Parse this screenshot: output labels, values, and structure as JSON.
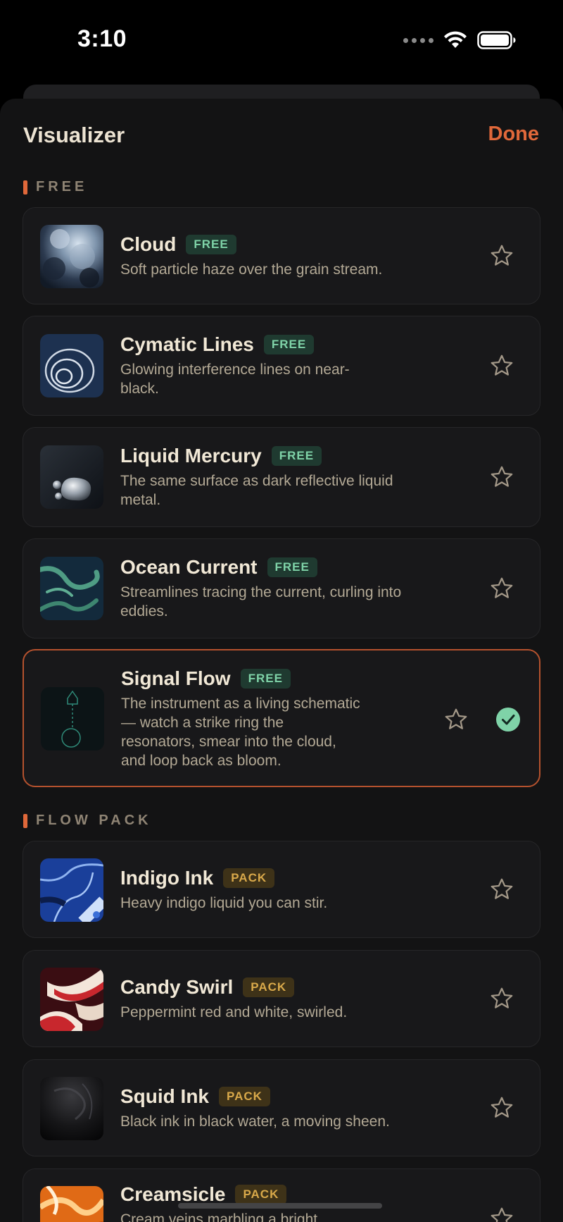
{
  "status_bar": {
    "time": "3:10"
  },
  "header": {
    "title": "Visualizer",
    "done_label": "Done"
  },
  "sections": [
    {
      "label": "FREE"
    },
    {
      "label": "FLOW PACK"
    }
  ],
  "items": [
    {
      "title": "Cloud",
      "badge": "FREE",
      "description": "Soft particle haze over the grain stream."
    },
    {
      "title": "Cymatic Lines",
      "badge": "FREE",
      "description": "Glowing interference lines on near-black."
    },
    {
      "title": "Liquid Mercury",
      "badge": "FREE",
      "description": "The same surface as dark reflective liquid metal."
    },
    {
      "title": "Ocean Current",
      "badge": "FREE",
      "description": "Streamlines tracing the current, curling into eddies."
    },
    {
      "title": "Signal Flow",
      "badge": "FREE",
      "description": "The instrument as a living schematic — watch a strike ring the resonators, smear into the cloud, and loop back as bloom.",
      "selected": true
    },
    {
      "title": "Indigo Ink",
      "badge": "PACK",
      "description": "Heavy indigo liquid you can stir."
    },
    {
      "title": "Candy Swirl",
      "badge": "PACK",
      "description": "Peppermint red and white, swirled."
    },
    {
      "title": "Squid Ink",
      "badge": "PACK",
      "description": "Black ink in black water, a moving sheen."
    },
    {
      "title": "Creamsicle",
      "badge": "PACK",
      "description": "Cream veins marbling a bright"
    }
  ],
  "colors": {
    "accent": "#E0683A",
    "free_badge": "#7fd3a8",
    "pack_badge": "#d9a94a",
    "selected_check": "#7fd3a8"
  },
  "icons": {
    "star": "star-icon",
    "check": "checkmark-circle-icon",
    "wifi": "wifi-icon",
    "battery": "battery-icon"
  }
}
